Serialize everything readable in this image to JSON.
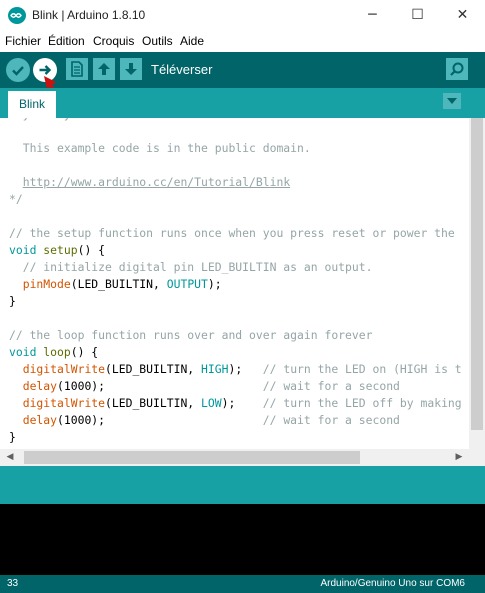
{
  "window": {
    "title": "Blink | Arduino 1.8.10",
    "minimize_glyph": "─",
    "maximize_glyph": "☐",
    "close_glyph": "✕"
  },
  "menu": [
    "Fichier",
    "Édition",
    "Croquis",
    "Outils",
    "Aide"
  ],
  "toolbar": {
    "hover_label": "Téléverser",
    "buttons": [
      "verify-icon",
      "upload-icon",
      "new-icon",
      "open-icon",
      "save-icon",
      "serial-monitor-icon"
    ]
  },
  "tabs": [
    {
      "label": "Blink",
      "active": true
    }
  ],
  "editor": {
    "lines": [
      [
        {
          "t": " by Colby Newman",
          "c": "com"
        }
      ],
      [
        {
          "t": "",
          "c": "plain"
        }
      ],
      [
        {
          "t": "  This example code is in the public domain.",
          "c": "com"
        }
      ],
      [
        {
          "t": "",
          "c": "plain"
        }
      ],
      [
        {
          "t": "  ",
          "c": "com"
        },
        {
          "t": "http://www.arduino.cc/en/Tutorial/Blink",
          "c": "link"
        }
      ],
      [
        {
          "t": "*/",
          "c": "com"
        }
      ],
      [
        {
          "t": "",
          "c": "plain"
        }
      ],
      [
        {
          "t": "// the setup function runs once when you press reset or power the",
          "c": "com"
        }
      ],
      [
        {
          "t": "void",
          "c": "type"
        },
        {
          "t": " ",
          "c": "dark"
        },
        {
          "t": "setup",
          "c": "fnkw"
        },
        {
          "t": "() {",
          "c": "dark"
        }
      ],
      [
        {
          "t": "  // initialize digital pin LED_BUILTIN as an output.",
          "c": "com"
        }
      ],
      [
        {
          "t": "  ",
          "c": "dark"
        },
        {
          "t": "pinMode",
          "c": "fn"
        },
        {
          "t": "(LED_BUILTIN, ",
          "c": "dark"
        },
        {
          "t": "OUTPUT",
          "c": "const"
        },
        {
          "t": ");",
          "c": "dark"
        }
      ],
      [
        {
          "t": "}",
          "c": "dark"
        }
      ],
      [
        {
          "t": "",
          "c": "plain"
        }
      ],
      [
        {
          "t": "// the loop function runs over and over again forever",
          "c": "com"
        }
      ],
      [
        {
          "t": "void",
          "c": "type"
        },
        {
          "t": " ",
          "c": "dark"
        },
        {
          "t": "loop",
          "c": "fnkw"
        },
        {
          "t": "() {",
          "c": "dark"
        }
      ],
      [
        {
          "t": "  ",
          "c": "dark"
        },
        {
          "t": "digitalWrite",
          "c": "fn"
        },
        {
          "t": "(LED_BUILTIN, ",
          "c": "dark"
        },
        {
          "t": "HIGH",
          "c": "const"
        },
        {
          "t": ");   ",
          "c": "dark"
        },
        {
          "t": "// turn the LED on (HIGH is t",
          "c": "com"
        }
      ],
      [
        {
          "t": "  ",
          "c": "dark"
        },
        {
          "t": "delay",
          "c": "fn"
        },
        {
          "t": "(1000);                       ",
          "c": "dark"
        },
        {
          "t": "// wait for a second",
          "c": "com"
        }
      ],
      [
        {
          "t": "  ",
          "c": "dark"
        },
        {
          "t": "digitalWrite",
          "c": "fn"
        },
        {
          "t": "(LED_BUILTIN, ",
          "c": "dark"
        },
        {
          "t": "LOW",
          "c": "const"
        },
        {
          "t": ");    ",
          "c": "dark"
        },
        {
          "t": "// turn the LED off by making",
          "c": "com"
        }
      ],
      [
        {
          "t": "  ",
          "c": "dark"
        },
        {
          "t": "delay",
          "c": "fn"
        },
        {
          "t": "(1000);                       ",
          "c": "dark"
        },
        {
          "t": "// wait for a second",
          "c": "com"
        }
      ],
      [
        {
          "t": "}",
          "c": "dark"
        }
      ]
    ]
  },
  "status": {
    "line_number": "33",
    "board": "Arduino/Genuino Uno sur COM6"
  },
  "colors": {
    "toolbar": "#006468",
    "tabbar": "#17a1a5",
    "button": "#4db7bb",
    "annotation_arrow": "#cc1111"
  }
}
